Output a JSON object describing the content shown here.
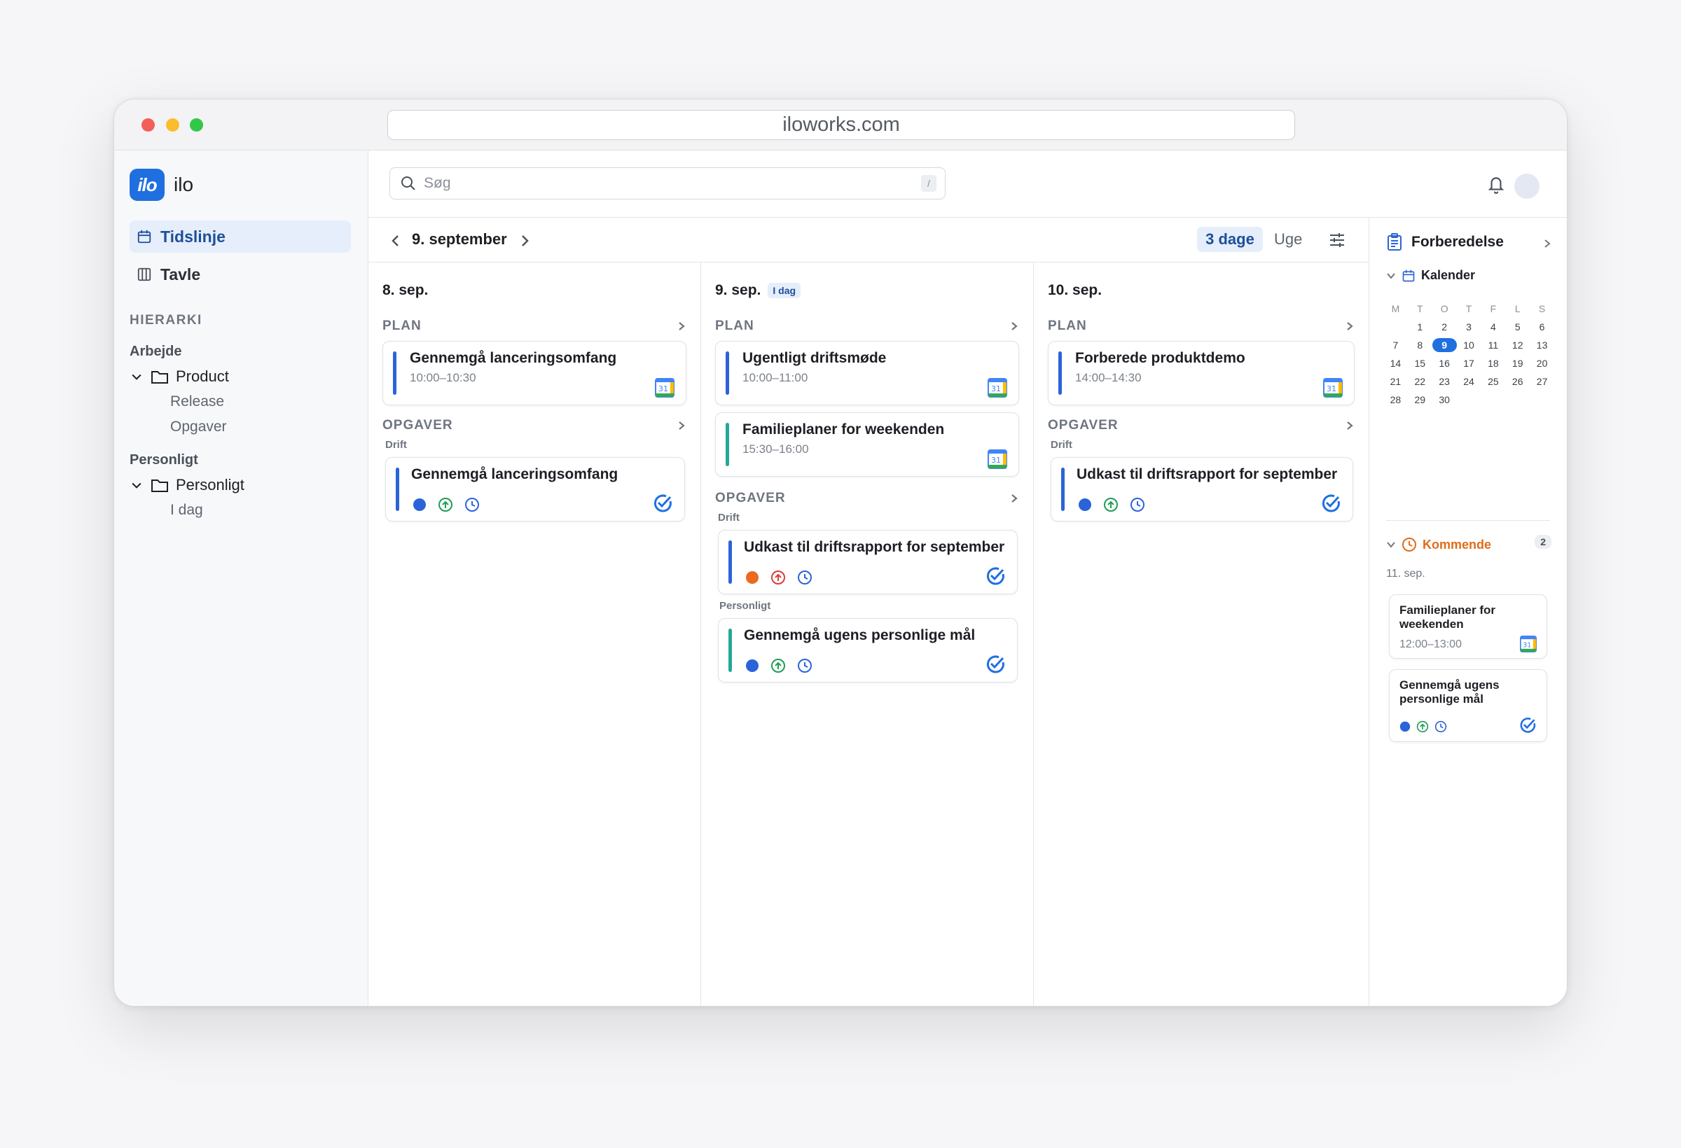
{
  "browser": {
    "url": "iloworks.com"
  },
  "app": {
    "logo_mark": "ilo",
    "name": "ilo"
  },
  "sidebar": {
    "nav": [
      {
        "label": "Tidslinje",
        "active": true
      },
      {
        "label": "Tavle",
        "active": false
      }
    ],
    "hierarchy_label": "HIERARKI",
    "groups": [
      {
        "label": "Arbejde",
        "folder": "Product",
        "children": [
          "Release",
          "Opgaver"
        ]
      },
      {
        "label": "Personligt",
        "folder": "Personligt",
        "children": [
          "I dag"
        ]
      }
    ]
  },
  "search": {
    "placeholder": "Søg",
    "shortcut": "/"
  },
  "timeline": {
    "current_date": "9. september",
    "views": {
      "active": "3 dage",
      "other": "Uge"
    },
    "columns": [
      {
        "date": "8. sep.",
        "plan_label": "PLAN",
        "plan": [
          {
            "title": "Gennemgå lanceringsomfang",
            "time": "10:00–10:30"
          }
        ],
        "tasks_label": "OPGAVER",
        "task_groups": [
          {
            "label": "Drift",
            "tasks": [
              {
                "title": "Gennemgå lanceringsomfang"
              }
            ]
          }
        ]
      },
      {
        "date": "9. sep.",
        "badge": "I dag",
        "plan_label": "PLAN",
        "plan": [
          {
            "title": "Ugentligt driftsmøde",
            "time": "10:00–11:00"
          },
          {
            "title": "Familieplaner for weekenden",
            "time": "15:30–16:00"
          }
        ],
        "tasks_label": "OPGAVER",
        "task_groups": [
          {
            "label": "Drift",
            "tasks": [
              {
                "title": "Udkast til driftsrapport for september"
              }
            ]
          },
          {
            "label": "Personligt",
            "tasks": [
              {
                "title": "Gennemgå ugens personlige mål"
              }
            ]
          }
        ]
      },
      {
        "date": "10. sep.",
        "plan_label": "PLAN",
        "plan": [
          {
            "title": "Forberede produktdemo",
            "time": "14:00–14:30"
          }
        ],
        "tasks_label": "OPGAVER",
        "task_groups": [
          {
            "label": "Drift",
            "tasks": [
              {
                "title": "Udkast til driftsrapport for september"
              }
            ]
          }
        ]
      }
    ]
  },
  "right_panel": {
    "title": "Forberedelse",
    "calendar": {
      "label": "Kalender",
      "weekdays": [
        "M",
        "T",
        "O",
        "T",
        "F",
        "L",
        "S"
      ],
      "selected_day": "9",
      "weeks": [
        [
          "",
          "1",
          "2",
          "3",
          "4",
          "5",
          "6"
        ],
        [
          "7",
          "8",
          "9",
          "10",
          "11",
          "12",
          "13"
        ],
        [
          "14",
          "15",
          "16",
          "17",
          "18",
          "19",
          "20"
        ],
        [
          "21",
          "22",
          "23",
          "24",
          "25",
          "26",
          "27"
        ],
        [
          "28",
          "29",
          "30",
          "",
          "",
          "",
          ""
        ]
      ]
    },
    "upcoming": {
      "label": "Kommende",
      "count": "2",
      "date": "11. sep.",
      "items": [
        {
          "title": "Familieplaner for weekenden",
          "time": "12:00–13:00"
        },
        {
          "title": "Gennemgå ugens personlige mål"
        }
      ]
    }
  },
  "colors": {
    "accent": "#1f6fe0",
    "bar_blue": "#2b64d8",
    "bar_teal": "#26a69a",
    "upcoming": "#e06c1a",
    "status_blue": "#2b64d8",
    "status_orange": "#ea6a1f",
    "priority_green": "#1f9d55",
    "priority_red": "#e03a3a"
  }
}
